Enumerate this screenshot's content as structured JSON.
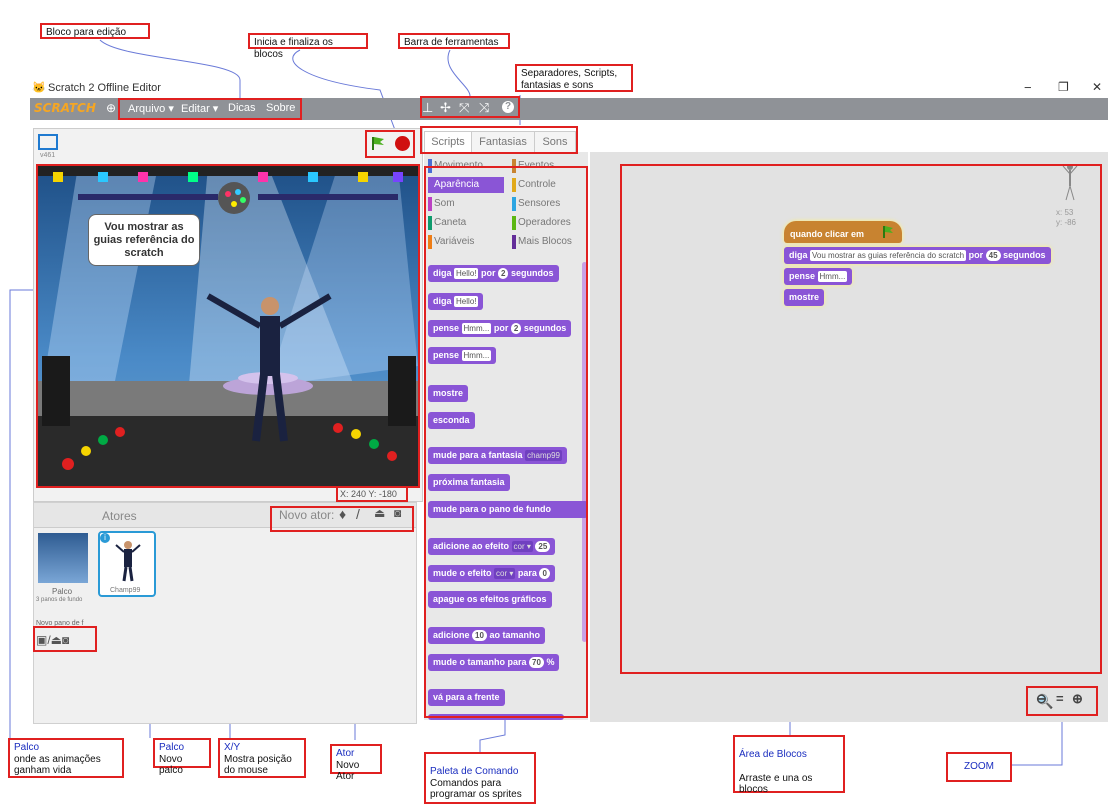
{
  "window": {
    "title": "Scratch 2 Offline Editor",
    "controls": [
      "−",
      "❐",
      "✕"
    ]
  },
  "menubar": {
    "logo": "SCRATCH",
    "globe_icon": "globe-icon",
    "items": [
      "Arquivo ▾",
      "Editar ▾",
      "Dicas",
      "Sobre"
    ]
  },
  "toolbar": {
    "icons": [
      "stamp-icon",
      "scissors-icon",
      "grow-icon",
      "shrink-icon",
      "help-icon"
    ]
  },
  "stage": {
    "version": "v461",
    "speech": "Vou mostrar as guias referência do scratch",
    "coords": "X: 240   Y: -180",
    "green_flag_color": "#4caf20",
    "stop_color": "#d01010"
  },
  "tabs": [
    "Scripts",
    "Fantasias",
    "Sons"
  ],
  "categories": [
    {
      "label": "Movimento",
      "color": "#4a6cd4"
    },
    {
      "label": "Eventos",
      "color": "#c88330"
    },
    {
      "label": "Aparência",
      "color": "#8a55d6",
      "active": true
    },
    {
      "label": "Controle",
      "color": "#e1a91a"
    },
    {
      "label": "Som",
      "color": "#bb42c3"
    },
    {
      "label": "Sensores",
      "color": "#2ca5e2"
    },
    {
      "label": "Caneta",
      "color": "#0e9a6c"
    },
    {
      "label": "Operadores",
      "color": "#5cb712"
    },
    {
      "label": "Variáveis",
      "color": "#ee7d16"
    },
    {
      "label": "Mais Blocos",
      "color": "#632d99"
    }
  ],
  "palette_blocks": {
    "b1": {
      "a": "diga",
      "i": "Hello!",
      "b": "por",
      "n": "2",
      "c": "segundos"
    },
    "b2": {
      "a": "diga",
      "i": "Hello!"
    },
    "b3": {
      "a": "pense",
      "i": "Hmm...",
      "b": "por",
      "n": "2",
      "c": "segundos"
    },
    "b4": {
      "a": "pense",
      "i": "Hmm..."
    },
    "b5": "mostre",
    "b6": "esconda",
    "b7": {
      "a": "mude para a fantasia",
      "i": "champ99"
    },
    "b8": "próxima fantasia",
    "b9": "mude para o pano de fundo",
    "b10": {
      "a": "adicione ao efeito",
      "i": "cor ▾",
      "n": "25"
    },
    "b11": {
      "a": "mude o efeito",
      "i": "cor ▾",
      "b": "para",
      "n": "0"
    },
    "b12": "apague os efeitos gráficos",
    "b13": {
      "a": "adicione",
      "n": "10",
      "b": "ao tamanho"
    },
    "b14": {
      "a": "mude o tamanho para",
      "n": "70",
      "c": "%"
    },
    "b15": "vá para a frente"
  },
  "script": {
    "hat": "quando clicar em",
    "say": {
      "a": "diga",
      "i": "Vou mostrar as guias referência do scratch",
      "b": "por",
      "n": "45",
      "c": "segundos"
    },
    "think": {
      "a": "pense",
      "i": "Hmm..."
    },
    "show": "mostre",
    "sprite_x": "x: 53",
    "sprite_y": "y: -86"
  },
  "sprites_panel": {
    "header": "Atores",
    "new_sprite": "Novo ator:",
    "stage_label": "Palco",
    "stage_sub": "3 panos de fundo",
    "new_backdrop": "Novo pano de f",
    "sprite_name": "Champ99"
  },
  "callouts": {
    "bloco": "Bloco para edição",
    "inicia": "Inicia e finaliza os blocos",
    "barra": "Barra de ferramentas",
    "separadores": "Separadores, Scripts, fantasias e sons",
    "palco1_t": "Palco",
    "palco1_s": "onde as animações ganham vida",
    "palco2_t": "Palco",
    "palco2_s": "Novo palco",
    "xy_t": "X/Y",
    "xy_s": "Mostra posição do mouse",
    "ator_t": "Ator",
    "ator_s": "Novo Ator",
    "paleta_t": "Paleta de Comando",
    "paleta_s": "Comandos para programar os sprites",
    "area_t": "Área de Blocos",
    "area_s": "Arraste e una os blocos",
    "zoom": "ZOOM"
  }
}
